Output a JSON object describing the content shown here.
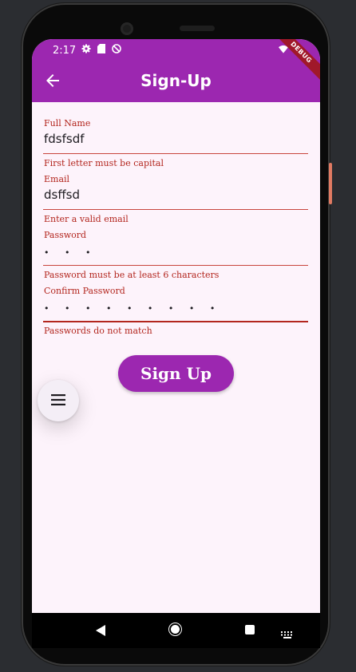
{
  "status_bar": {
    "time": "2:17",
    "left_icons": [
      "settings-gear-icon",
      "sd-card-icon",
      "do-not-disturb-icon"
    ],
    "right_icons": [
      "wifi-icon",
      "battery-icon"
    ]
  },
  "app_bar": {
    "title": "Sign-Up",
    "back_icon": "arrow-back-icon",
    "debug_banner": "DEBUG",
    "color": "#9c27b0"
  },
  "form": {
    "fields": [
      {
        "label": "Full Name",
        "value": "fdsfsdf",
        "error": "First letter must be capital",
        "type": "text"
      },
      {
        "label": "Email",
        "value": "dsffsd",
        "error": "Enter a valid email",
        "type": "text"
      },
      {
        "label": "Password",
        "value": "• • •",
        "error": "Password must be at least 6 characters",
        "type": "password"
      },
      {
        "label": "Confirm Password",
        "value": "• • • • • • • • •",
        "error": "Passwords do not match",
        "type": "password"
      }
    ],
    "error_color": "#b3261e"
  },
  "buttons": {
    "sign_up": "Sign Up"
  },
  "fab": {
    "icon": "menu-icon"
  },
  "nav_bar": {
    "icons": [
      "nav-back-icon",
      "nav-home-icon",
      "nav-recents-icon",
      "keyboard-icon"
    ]
  }
}
